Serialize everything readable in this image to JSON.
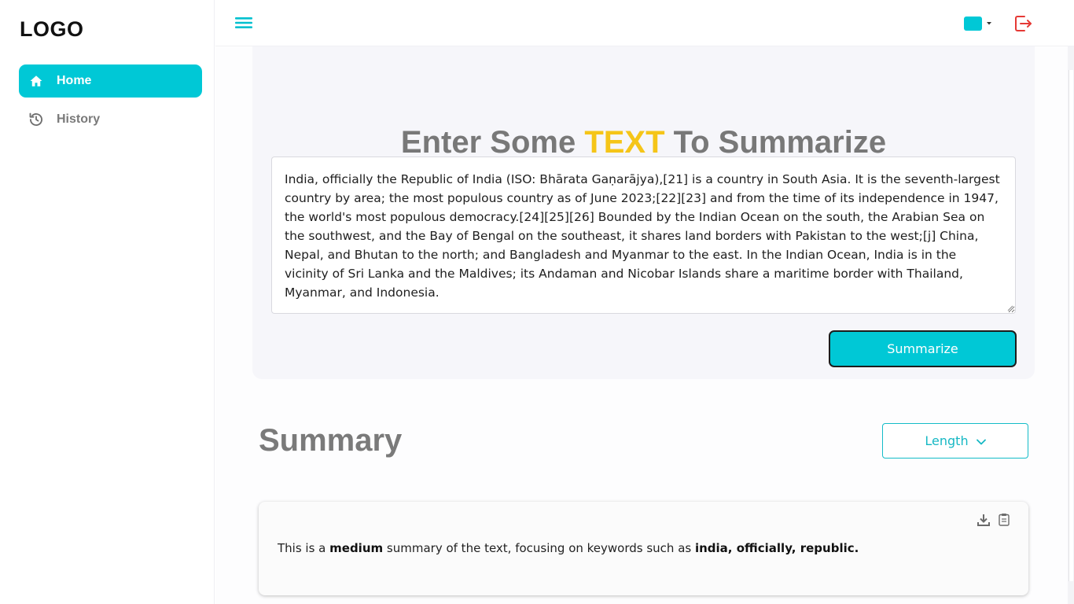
{
  "app": {
    "logo": "LOGO"
  },
  "sidebar": {
    "items": [
      {
        "label": "Home",
        "icon": "home-icon",
        "active": true
      },
      {
        "label": "History",
        "icon": "history-icon",
        "active": false
      }
    ]
  },
  "topbar": {
    "menu_icon": "hamburger-menu-icon",
    "color_swatch": "#00c8d6",
    "logout_icon": "logout-icon"
  },
  "input_section": {
    "headline_prefix": "Enter Some ",
    "headline_accent": "TEXT",
    "headline_suffix": " To Summarize",
    "text_value": "India, officially the Republic of India (ISO: Bhārata Gaṇarājya),[21] is a country in South Asia. It is the seventh-largest country by area; the most populous country as of June 2023;[22][23] and from the time of its independence in 1947, the world's most populous democracy.[24][25][26] Bounded by the Indian Ocean on the south, the Arabian Sea on the southwest, and the Bay of Bengal on the southeast, it shares land borders with Pakistan to the west;[j] China, Nepal, and Bhutan to the north; and Bangladesh and Myanmar to the east. In the Indian Ocean, India is in the vicinity of Sri Lanka and the Maldives; its Andaman and Nicobar Islands share a maritime border with Thailand, Myanmar, and Indonesia.",
    "submit_label": "Summarize"
  },
  "summary_section": {
    "title": "Summary",
    "length_label": "Length",
    "text_part1": "This is a ",
    "text_bold1": "medium",
    "text_part2": " summary of the text, focusing on keywords such as ",
    "text_bold2": "india, officially, republic."
  },
  "colors": {
    "accent": "#00c8d6",
    "headline_accent": "#f5c518",
    "logout": "#e53935"
  }
}
